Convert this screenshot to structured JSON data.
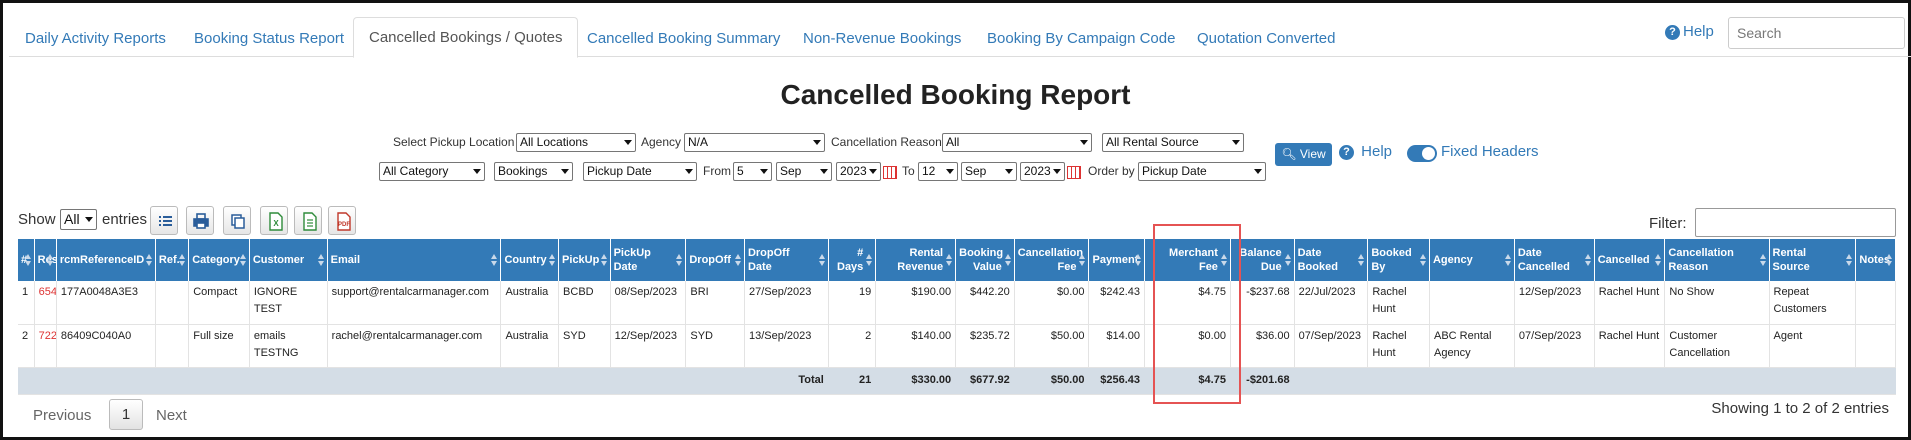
{
  "tabs": [
    {
      "label": "Daily Activity Reports",
      "active": false
    },
    {
      "label": "Booking Status Report",
      "active": false
    },
    {
      "label": "Cancelled Bookings / Quotes",
      "active": true
    },
    {
      "label": "Cancelled Booking Summary",
      "active": false
    },
    {
      "label": "Non-Revenue Bookings",
      "active": false
    },
    {
      "label": "Booking By Campaign Code",
      "active": false
    },
    {
      "label": "Quotation Converted",
      "active": false
    }
  ],
  "header": {
    "help_label": "Help",
    "search_placeholder": "Search"
  },
  "page_title": "Cancelled Booking Report",
  "filters": {
    "pickup_location_label": "Select Pickup Location",
    "pickup_location_value": "All Locations",
    "agency_label": "Agency",
    "agency_value": "N/A",
    "cancellation_reason_label": "Cancellation Reason",
    "cancellation_reason_value": "All",
    "rental_source_value": "All Rental Source",
    "category_value": "All Category",
    "type_value": "Bookings",
    "date_type_value": "Pickup Date",
    "from_label": "From",
    "from_day": "5",
    "from_month": "Sep",
    "from_year": "2023",
    "to_label": "To",
    "to_day": "12",
    "to_month": "Sep",
    "to_year": "2023",
    "order_by_label": "Order by",
    "order_by_value": "Pickup Date",
    "view_label": "View",
    "help_label": "Help",
    "fixed_headers_label": "Fixed Headers",
    "fixed_headers_on": true
  },
  "table_controls": {
    "show_label": "Show",
    "show_value": "All",
    "entries_label": "entries",
    "toolbar_icons": [
      "column-list-icon",
      "print-icon",
      "copy-icon",
      "excel-icon",
      "csv-icon",
      "pdf-icon"
    ],
    "filter_label": "Filter:"
  },
  "table": {
    "columns": [
      "#",
      "Res.",
      "rcmReferenceID",
      "Ref.",
      "Category",
      "Customer",
      "Email",
      "Country",
      "PickUp",
      "PickUp Date",
      "DropOff",
      "DropOff Date",
      "# Days",
      "Rental Revenue",
      "Booking Value",
      "Cancellation Fee",
      "Payment",
      "Merchant Fee",
      "Balance Due",
      "Date Booked",
      "Booked By",
      "Agency",
      "Date Cancelled",
      "Cancelled",
      "Cancellation Reason",
      "Rental Source",
      "Notes"
    ],
    "rows": [
      [
        "1",
        "654",
        "177A0048A3E3",
        "",
        "Compact",
        "IGNORE TEST",
        "support@rentalcarmanager.com",
        "Australia",
        "BCBD",
        "08/Sep/2023",
        "BRI",
        "27/Sep/2023",
        "19",
        "$190.00",
        "$442.20",
        "$0.00",
        "$242.43",
        "$4.75",
        "-$237.68",
        "22/Jul/2023",
        "Rachel Hunt",
        "",
        "12/Sep/2023",
        "Rachel Hunt",
        "No Show",
        "Repeat Customers",
        ""
      ],
      [
        "2",
        "722",
        "86409C040A0",
        "",
        "Full size",
        "emails TESTNG",
        "rachel@rentalcarmanager.com",
        "Australia",
        "SYD",
        "12/Sep/2023",
        "SYD",
        "13/Sep/2023",
        "2",
        "$140.00",
        "$235.72",
        "$50.00",
        "$14.00",
        "$0.00",
        "$36.00",
        "07/Sep/2023",
        "Rachel Hunt",
        "ABC Rental Agency",
        "07/Sep/2023",
        "Rachel Hunt",
        "Customer Cancellation",
        "Agent",
        ""
      ]
    ],
    "total": {
      "label": "Total",
      "days": "21",
      "rental_revenue": "$330.00",
      "booking_value": "$677.92",
      "cancellation_fee": "$50.00",
      "payment": "$256.43",
      "merchant_fee": "$4.75",
      "balance_due": "-$201.68"
    }
  },
  "pagination": {
    "previous_label": "Previous",
    "current_page": "1",
    "next_label": "Next",
    "info": "Showing 1 to 2 of 2 entries"
  },
  "colors": {
    "header_bg": "#337ab7",
    "link": "#337ab7",
    "res_link": "#dd3333",
    "highlight": "#e55353",
    "total_row_bg": "#d4dde6"
  }
}
